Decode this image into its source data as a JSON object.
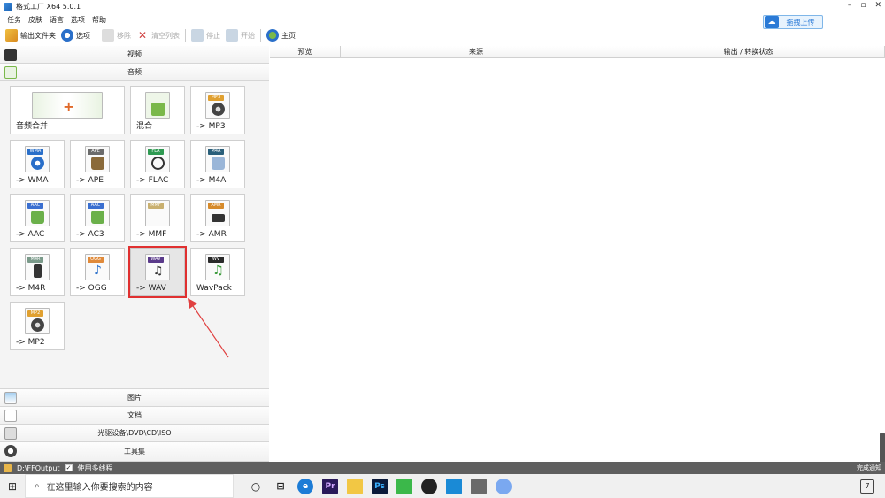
{
  "window": {
    "title": "格式工厂 X64 5.0.1",
    "controls": [
      "–",
      "▫",
      "✕"
    ]
  },
  "menu": [
    "任务",
    "皮肤",
    "语言",
    "选项",
    "帮助"
  ],
  "upload_button": {
    "label": "拖拽上传",
    "color": "#2a7ad6"
  },
  "toolbar": {
    "output_folder": "输出文件夹",
    "options": "选项",
    "remove": "移除",
    "clear_list": "清空列表",
    "stop": "停止",
    "start": "开始",
    "home": "主页"
  },
  "categories": {
    "video": "视频",
    "audio": "音频",
    "image": "图片",
    "document": "文档",
    "disc": "光驱设备\\DVD\\CD\\ISO",
    "tools": "工具集"
  },
  "audio_tiles": [
    {
      "label": "音频合并",
      "badge": "",
      "badge_color": "#6bb04a"
    },
    {
      "label": "混合",
      "badge": "",
      "badge_color": "#6bb04a"
    },
    {
      "label": "-> MP3",
      "badge": "MP3",
      "badge_color": "#e0a030"
    },
    {
      "label": "-> WMA",
      "badge": "WMA",
      "badge_color": "#2a6fc9"
    },
    {
      "label": "-> APE",
      "badge": "APE",
      "badge_color": "#6b6b6b"
    },
    {
      "label": "-> FLAC",
      "badge": "FLA",
      "badge_color": "#2f9a52"
    },
    {
      "label": "-> M4A",
      "badge": "M4A",
      "badge_color": "#2a5f7a"
    },
    {
      "label": "-> AAC",
      "badge": "AAC",
      "badge_color": "#3a6fd0"
    },
    {
      "label": "-> AC3",
      "badge": "AAC",
      "badge_color": "#3a6fd0"
    },
    {
      "label": "-> MMF",
      "badge": "MMF",
      "badge_color": "#c9b070"
    },
    {
      "label": "-> AMR",
      "badge": "AMR",
      "badge_color": "#d68a2a"
    },
    {
      "label": "-> M4R",
      "badge": "M4R",
      "badge_color": "#7a9a8a"
    },
    {
      "label": "-> OGG",
      "badge": "OGG",
      "badge_color": "#e08a3a"
    },
    {
      "label": "-> WAV",
      "badge": "WAV",
      "badge_color": "#5a3a8a"
    },
    {
      "label": "WavPack",
      "badge": "WV",
      "badge_color": "#2a2a2a"
    },
    {
      "label": "-> MP2",
      "badge": "MP2",
      "badge_color": "#e0a030"
    }
  ],
  "selected_tile": "-> WAV",
  "columns": {
    "preview": "预览",
    "source": "来源",
    "output_status": "输出 / 转换状态"
  },
  "statusbar": {
    "output_path": "D:\\FFOutput",
    "multithread": "使用多线程",
    "notify": "完成通知"
  },
  "taskbar": {
    "search_placeholder": "在这里输入你要搜索的内容",
    "notification_count": "7"
  }
}
